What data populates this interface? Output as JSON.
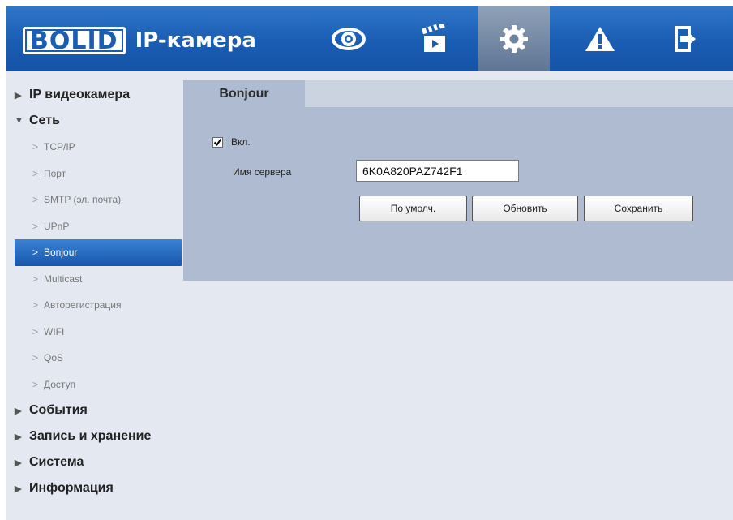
{
  "header": {
    "logo_text": "BOLID",
    "app_title": "IP-камера",
    "nav": [
      {
        "name": "live-view",
        "icon": "eye-icon"
      },
      {
        "name": "playback",
        "icon": "clapperboard-icon"
      },
      {
        "name": "settings",
        "icon": "gear-icon",
        "active": true
      },
      {
        "name": "alarm",
        "icon": "warning-icon"
      },
      {
        "name": "logout",
        "icon": "exit-icon"
      }
    ]
  },
  "sidebar": {
    "sections": [
      {
        "label": "IP видеокамера",
        "arrow": "▶"
      },
      {
        "label": "Сеть",
        "arrow": "▼"
      },
      {
        "label": "События",
        "arrow": "▶"
      },
      {
        "label": "Запись и хранение",
        "arrow": "▶"
      },
      {
        "label": "Система",
        "arrow": "▶"
      },
      {
        "label": "Информация",
        "arrow": "▶"
      }
    ],
    "network_items": [
      {
        "label": "TCP/IP"
      },
      {
        "label": "Порт"
      },
      {
        "label": "SMTP (эл. почта)"
      },
      {
        "label": "UPnP"
      },
      {
        "label": "Bonjour",
        "selected": true
      },
      {
        "label": "Multicast"
      },
      {
        "label": "Авторегистрация"
      },
      {
        "label": "WIFI"
      },
      {
        "label": "QoS"
      },
      {
        "label": "Доступ"
      }
    ],
    "chevron": ">"
  },
  "content": {
    "tab_label": "Bonjour",
    "enable_label": "Вкл.",
    "enable_checked": true,
    "server_name_label": "Имя сервера",
    "server_name_value": "6K0A820PAZ742F1",
    "buttons": {
      "default": "По умолч.",
      "refresh": "Обновить",
      "save": "Сохранить"
    }
  },
  "colors": {
    "header_blue": "#1a5db3",
    "panel": "#aebbd1",
    "background": "#e4e8f0",
    "selected": "#1757ad"
  }
}
